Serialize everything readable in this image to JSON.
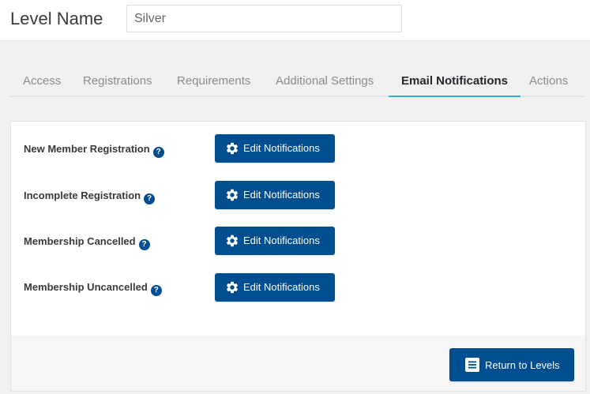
{
  "header": {
    "label": "Level Name",
    "level_value": "Silver"
  },
  "tabs": [
    {
      "label": "Access"
    },
    {
      "label": "Registrations"
    },
    {
      "label": "Requirements"
    },
    {
      "label": "Additional Settings"
    },
    {
      "label": "Email Notifications",
      "active": true
    },
    {
      "label": "Actions"
    }
  ],
  "notifications": [
    {
      "label": "New Member Registration",
      "button": "Edit Notifications"
    },
    {
      "label": "Incomplete Registration",
      "button": "Edit Notifications"
    },
    {
      "label": "Membership Cancelled",
      "button": "Edit Notifications"
    },
    {
      "label": "Membership Uncancelled",
      "button": "Edit Notifications"
    }
  ],
  "help_glyph": "?",
  "footer": {
    "return_label": "Return to Levels"
  },
  "colors": {
    "primary_button": "#004e8f",
    "active_tab_underline": "#2ab5c6"
  },
  "icons": {
    "edit": "gear-icon",
    "help": "question-circle-icon",
    "return": "list-icon"
  }
}
